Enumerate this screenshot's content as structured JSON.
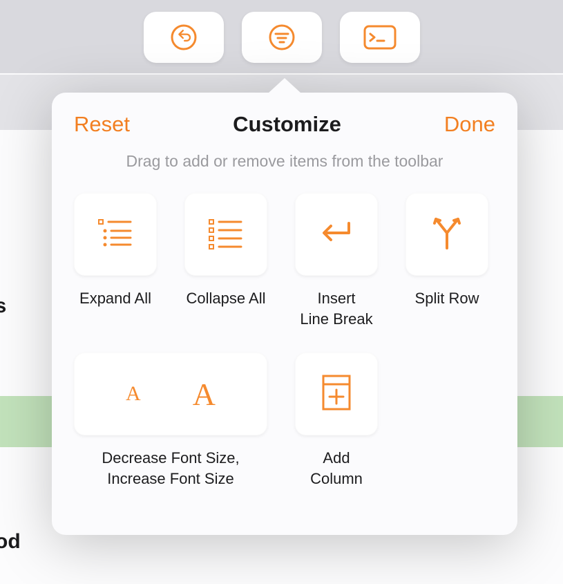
{
  "background": {
    "sideText1": "ons",
    "sideText2": "od"
  },
  "toolbar": {
    "buttons": [
      {
        "iconName": "undo-icon"
      },
      {
        "iconName": "filter-icon"
      },
      {
        "iconName": "terminal-icon"
      }
    ]
  },
  "popover": {
    "reset": "Reset",
    "title": "Customize",
    "done": "Done",
    "hint": "Drag to add or remove items from the toolbar",
    "items": {
      "expandAll": "Expand All",
      "collapseAll": "Collapse All",
      "insertLineBreak": "Insert\nLine Break",
      "splitRow": "Split Row",
      "fontSize": "Decrease Font Size, Increase Font Size",
      "addColumn": "Add Column"
    }
  },
  "colors": {
    "accent": "#f58a2e"
  }
}
